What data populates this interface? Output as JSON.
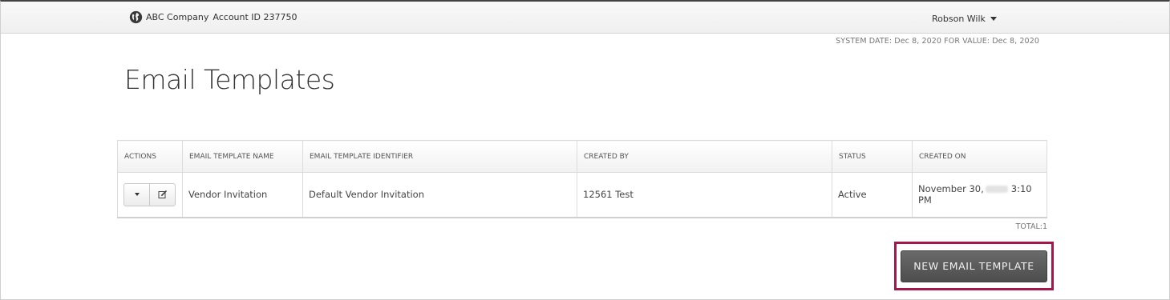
{
  "header": {
    "company": "ABC Company",
    "account": "Account ID 237750",
    "user": "Robson Wilk",
    "globe_icon": "globe-icon",
    "user_menu_icon": "chevron-down-icon"
  },
  "system_date": "SYSTEM DATE: Dec 8, 2020 FOR VALUE: Dec 8, 2020",
  "page_title": "Email Templates",
  "table": {
    "columns": [
      "ACTIONS",
      "EMAIL TEMPLATE NAME",
      "EMAIL TEMPLATE IDENTIFIER",
      "CREATED BY",
      "STATUS",
      "CREATED ON"
    ],
    "rows": [
      {
        "name": "Vendor Invitation",
        "identifier": "Default Vendor Invitation",
        "created_by": "12561 Test",
        "status": "Active",
        "created_on_date": "November 30,",
        "created_on_time": "3:10 PM"
      }
    ],
    "action_icons": [
      "dropdown-caret-icon",
      "edit-icon"
    ]
  },
  "total": "TOTAL:1",
  "new_button": "NEW EMAIL TEMPLATE",
  "colors": {
    "highlight": "#a3174a",
    "button": "#5a5a5a"
  }
}
